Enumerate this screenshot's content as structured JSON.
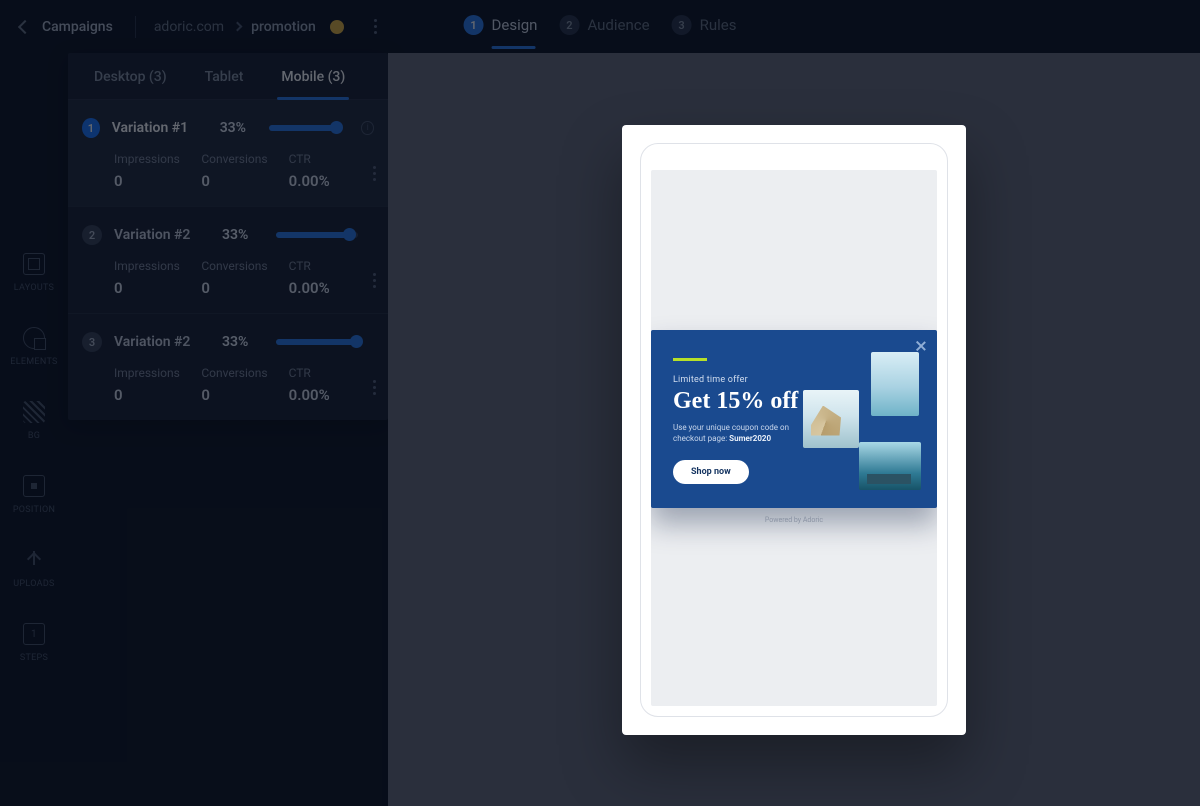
{
  "header": {
    "back_label": "Campaigns",
    "breadcrumb": {
      "site": "adoric.com",
      "campaign": "promotion"
    },
    "steps": [
      {
        "num": "1",
        "label": "Design",
        "active": true
      },
      {
        "num": "2",
        "label": "Audience",
        "active": false
      },
      {
        "num": "3",
        "label": "Rules",
        "active": false
      }
    ]
  },
  "rail": [
    {
      "key": "layouts",
      "label": "LAYOUTS"
    },
    {
      "key": "elements",
      "label": "ELEMENTS"
    },
    {
      "key": "bg",
      "label": "BG"
    },
    {
      "key": "position",
      "label": "POSITION"
    },
    {
      "key": "uploads",
      "label": "UPLOADS"
    },
    {
      "key": "steps",
      "label": "STEPS"
    }
  ],
  "tabs": [
    {
      "label": "Desktop (3)",
      "active": false
    },
    {
      "label": "Tablet",
      "active": false
    },
    {
      "label": "Mobile (3)",
      "active": true
    }
  ],
  "metrics_labels": {
    "impressions": "Impressions",
    "conversions": "Conversions",
    "ctr": "CTR"
  },
  "variations": [
    {
      "num": "1",
      "name": "Variation #1",
      "pct": "33%",
      "slider": 90,
      "impressions": "0",
      "conversions": "0",
      "ctr": "0.00%",
      "selected": true
    },
    {
      "num": "2",
      "name": "Variation #2",
      "pct": "33%",
      "slider": 88,
      "impressions": "0",
      "conversions": "0",
      "ctr": "0.00%",
      "selected": false
    },
    {
      "num": "3",
      "name": "Variation #2",
      "pct": "33%",
      "slider": 96,
      "impressions": "0",
      "conversions": "0",
      "ctr": "0.00%",
      "selected": false
    }
  ],
  "banner": {
    "kicker": "Limited time offer",
    "headline": "Get 15% off",
    "subcopy_a": "Use your unique coupon code on checkout page: ",
    "subcopy_b": "Sumer2020",
    "cta": "Shop now",
    "powered": "Powered by Adoric"
  }
}
